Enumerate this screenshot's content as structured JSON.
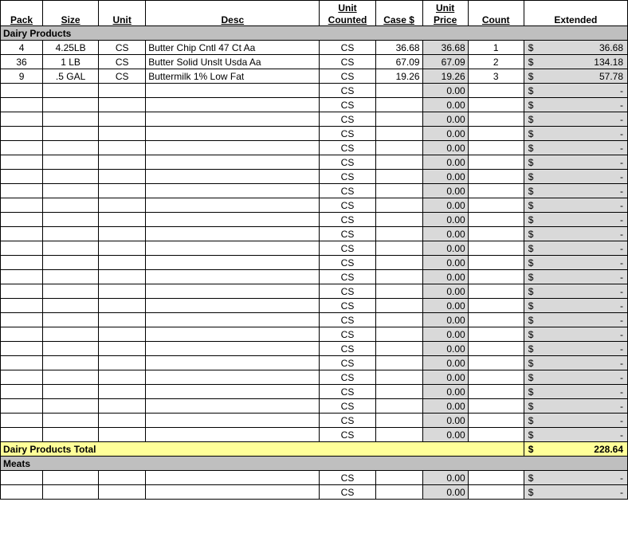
{
  "headers": {
    "pack": "Pack",
    "size": "Size",
    "unit": "Unit",
    "desc": "Desc",
    "unit_counted": "Unit Counted",
    "case": "Case $",
    "unit_price": "Unit Price",
    "count": "Count",
    "extended": "Extended"
  },
  "sections": [
    {
      "title": "Dairy Products",
      "rows": [
        {
          "pack": "4",
          "size": "4.25LB",
          "unit": "CS",
          "desc": "Butter Chip Cntl 47 Ct Aa",
          "uc": "CS",
          "case": "36.68",
          "up": "36.68",
          "count": "1",
          "ext": "36.68"
        },
        {
          "pack": "36",
          "size": "1 LB",
          "unit": "CS",
          "desc": "Butter Solid Unslt Usda Aa",
          "uc": "CS",
          "case": "67.09",
          "up": "67.09",
          "count": "2",
          "ext": "134.18"
        },
        {
          "pack": "9",
          "size": ".5 GAL",
          "unit": "CS",
          "desc": "Buttermilk 1% Low Fat",
          "uc": "CS",
          "case": "19.26",
          "up": "19.26",
          "count": "3",
          "ext": "57.78"
        },
        {
          "pack": "",
          "size": "",
          "unit": "",
          "desc": "",
          "uc": "CS",
          "case": "",
          "up": "0.00",
          "count": "",
          "ext": "-"
        },
        {
          "pack": "",
          "size": "",
          "unit": "",
          "desc": "",
          "uc": "CS",
          "case": "",
          "up": "0.00",
          "count": "",
          "ext": "-"
        },
        {
          "pack": "",
          "size": "",
          "unit": "",
          "desc": "",
          "uc": "CS",
          "case": "",
          "up": "0.00",
          "count": "",
          "ext": "-"
        },
        {
          "pack": "",
          "size": "",
          "unit": "",
          "desc": "",
          "uc": "CS",
          "case": "",
          "up": "0.00",
          "count": "",
          "ext": "-"
        },
        {
          "pack": "",
          "size": "",
          "unit": "",
          "desc": "",
          "uc": "CS",
          "case": "",
          "up": "0.00",
          "count": "",
          "ext": "-"
        },
        {
          "pack": "",
          "size": "",
          "unit": "",
          "desc": "",
          "uc": "CS",
          "case": "",
          "up": "0.00",
          "count": "",
          "ext": "-"
        },
        {
          "pack": "",
          "size": "",
          "unit": "",
          "desc": "",
          "uc": "CS",
          "case": "",
          "up": "0.00",
          "count": "",
          "ext": "-"
        },
        {
          "pack": "",
          "size": "",
          "unit": "",
          "desc": "",
          "uc": "CS",
          "case": "",
          "up": "0.00",
          "count": "",
          "ext": "-"
        },
        {
          "pack": "",
          "size": "",
          "unit": "",
          "desc": "",
          "uc": "CS",
          "case": "",
          "up": "0.00",
          "count": "",
          "ext": "-"
        },
        {
          "pack": "",
          "size": "",
          "unit": "",
          "desc": "",
          "uc": "CS",
          "case": "",
          "up": "0.00",
          "count": "",
          "ext": "-"
        },
        {
          "pack": "",
          "size": "",
          "unit": "",
          "desc": "",
          "uc": "CS",
          "case": "",
          "up": "0.00",
          "count": "",
          "ext": "-"
        },
        {
          "pack": "",
          "size": "",
          "unit": "",
          "desc": "",
          "uc": "CS",
          "case": "",
          "up": "0.00",
          "count": "",
          "ext": "-"
        },
        {
          "pack": "",
          "size": "",
          "unit": "",
          "desc": "",
          "uc": "CS",
          "case": "",
          "up": "0.00",
          "count": "",
          "ext": "-"
        },
        {
          "pack": "",
          "size": "",
          "unit": "",
          "desc": "",
          "uc": "CS",
          "case": "",
          "up": "0.00",
          "count": "",
          "ext": "-"
        },
        {
          "pack": "",
          "size": "",
          "unit": "",
          "desc": "",
          "uc": "CS",
          "case": "",
          "up": "0.00",
          "count": "",
          "ext": "-"
        },
        {
          "pack": "",
          "size": "",
          "unit": "",
          "desc": "",
          "uc": "CS",
          "case": "",
          "up": "0.00",
          "count": "",
          "ext": "-"
        },
        {
          "pack": "",
          "size": "",
          "unit": "",
          "desc": "",
          "uc": "CS",
          "case": "",
          "up": "0.00",
          "count": "",
          "ext": "-"
        },
        {
          "pack": "",
          "size": "",
          "unit": "",
          "desc": "",
          "uc": "CS",
          "case": "",
          "up": "0.00",
          "count": "",
          "ext": "-"
        },
        {
          "pack": "",
          "size": "",
          "unit": "",
          "desc": "",
          "uc": "CS",
          "case": "",
          "up": "0.00",
          "count": "",
          "ext": "-"
        },
        {
          "pack": "",
          "size": "",
          "unit": "",
          "desc": "",
          "uc": "CS",
          "case": "",
          "up": "0.00",
          "count": "",
          "ext": "-"
        },
        {
          "pack": "",
          "size": "",
          "unit": "",
          "desc": "",
          "uc": "CS",
          "case": "",
          "up": "0.00",
          "count": "",
          "ext": "-"
        },
        {
          "pack": "",
          "size": "",
          "unit": "",
          "desc": "",
          "uc": "CS",
          "case": "",
          "up": "0.00",
          "count": "",
          "ext": "-"
        },
        {
          "pack": "",
          "size": "",
          "unit": "",
          "desc": "",
          "uc": "CS",
          "case": "",
          "up": "0.00",
          "count": "",
          "ext": "-"
        },
        {
          "pack": "",
          "size": "",
          "unit": "",
          "desc": "",
          "uc": "CS",
          "case": "",
          "up": "0.00",
          "count": "",
          "ext": "-"
        },
        {
          "pack": "",
          "size": "",
          "unit": "",
          "desc": "",
          "uc": "CS",
          "case": "",
          "up": "0.00",
          "count": "",
          "ext": "-"
        }
      ],
      "total_label": "Dairy Products Total",
      "total_value": "228.64"
    },
    {
      "title": "Meats",
      "rows": [
        {
          "pack": "",
          "size": "",
          "unit": "",
          "desc": "",
          "uc": "CS",
          "case": "",
          "up": "0.00",
          "count": "",
          "ext": "-"
        },
        {
          "pack": "",
          "size": "",
          "unit": "",
          "desc": "",
          "uc": "CS",
          "case": "",
          "up": "0.00",
          "count": "",
          "ext": "-"
        }
      ]
    }
  ],
  "currency": "$"
}
